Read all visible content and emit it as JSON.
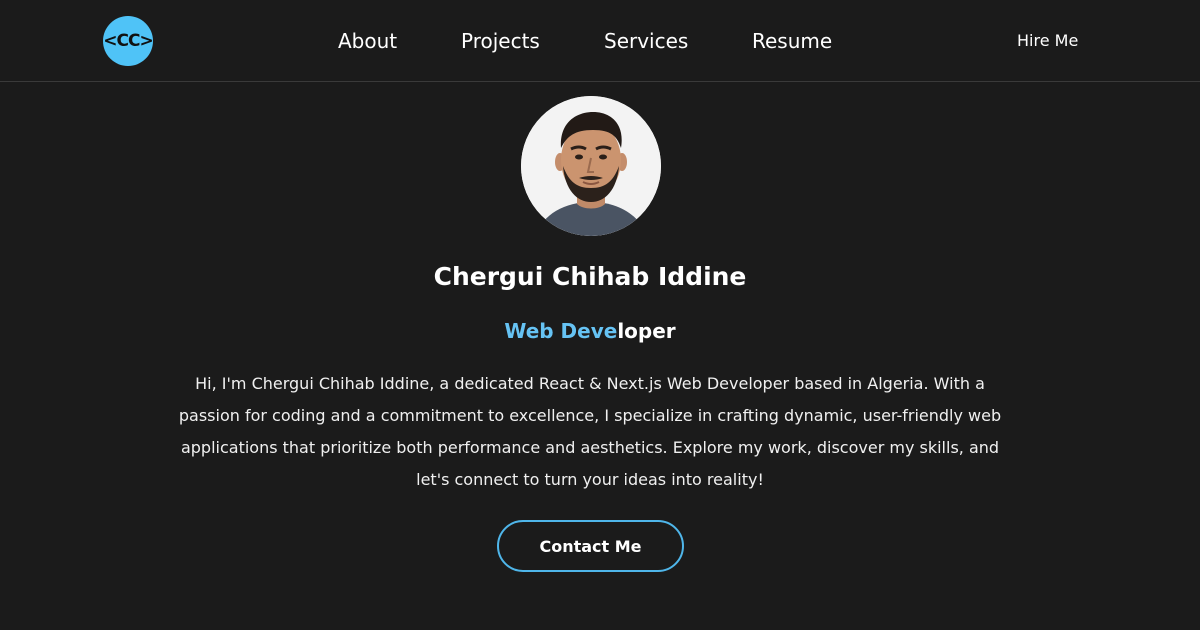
{
  "header": {
    "logo_text": "<CC>",
    "nav": [
      {
        "label": "About"
      },
      {
        "label": "Projects"
      },
      {
        "label": "Services"
      },
      {
        "label": "Resume"
      }
    ],
    "cta_label": "Hire Me"
  },
  "hero": {
    "avatar_icon": "profile-photo",
    "name": "Chergui Chihab Iddine",
    "role_part1": "Web Deve",
    "role_part2": "loper",
    "bio": "Hi, I'm Chergui Chihab Iddine, a dedicated React & Next.js Web Developer based in Algeria. With a passion for coding and a commitment to excellence, I specialize in crafting dynamic, user-friendly web applications that prioritize both performance and aesthetics. Explore my work, discover my skills, and let's connect to turn your ideas into reality!",
    "contact_label": "Contact Me"
  },
  "colors": {
    "background": "#1b1b1b",
    "accent": "#4fc3f7",
    "role_accent": "#66c3f4",
    "text": "#ffffff"
  }
}
